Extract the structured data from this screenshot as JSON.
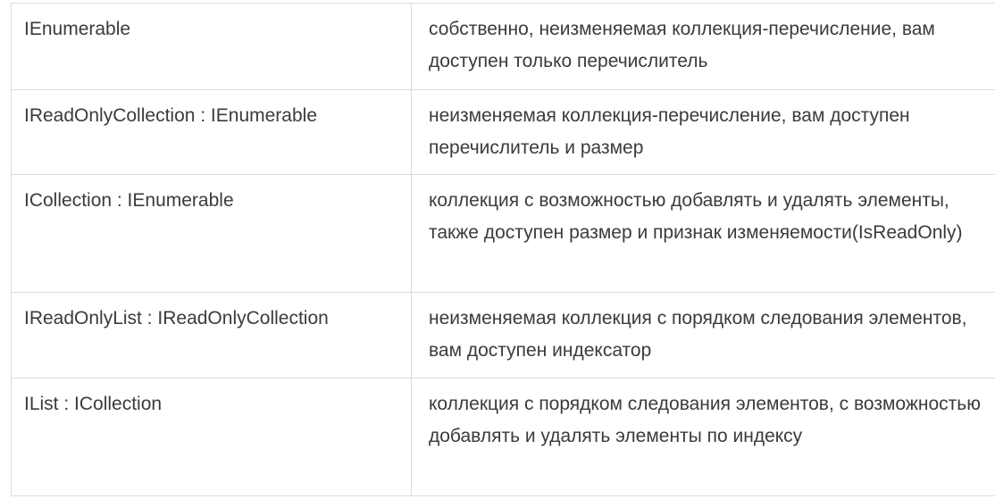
{
  "table": {
    "rows": [
      {
        "type": "IEnumerable",
        "description": "собственно, неизменяемая коллекция-перечисление, вам доступен только перечислитель"
      },
      {
        "type": "IReadOnlyCollection : IEnumerable",
        "description": "неизменяемая коллекция-перечисление, вам доступен перечислитель и размер"
      },
      {
        "type": "ICollection : IEnumerable",
        "description": "коллекция с возможностью добавлять и удалять элементы, также доступен размер и признак изменяемости(IsReadOnly)"
      },
      {
        "type": "IReadOnlyList : IReadOnlyCollection",
        "description": "неизменяемая коллекция с порядком следования элементов, вам доступен индексатор"
      },
      {
        "type": "IList : ICollection",
        "description": "коллекция с порядком следования элементов, с возможностью добавлять и удалять элементы по индексу"
      }
    ]
  }
}
